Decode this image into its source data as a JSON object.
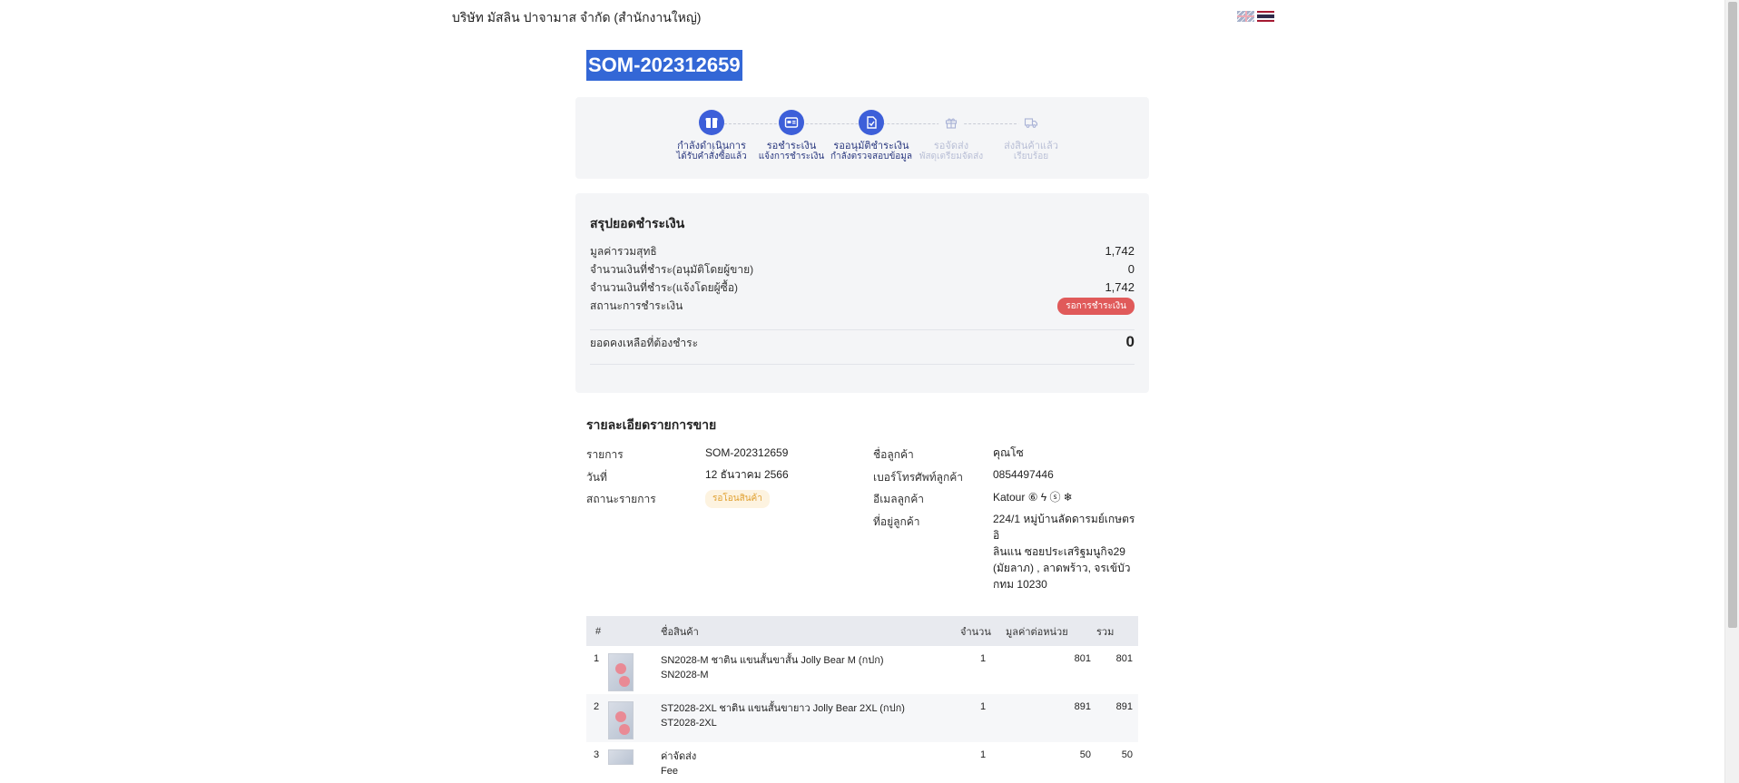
{
  "header": {
    "company": "บริษัท มัสลิน ปาจามาส จำกัด (สำนักงานใหญ่)"
  },
  "order": {
    "number": "SOM-202312659"
  },
  "steps": [
    {
      "title": "กำลังดำเนินการ",
      "sub": "ได้รับคำสั่งซื้อแล้ว",
      "icon": "box-icon",
      "active": true
    },
    {
      "title": "รอชำระเงิน",
      "sub": "แจ้งการชำระเงิน",
      "icon": "payment-card-icon",
      "active": true
    },
    {
      "title": "รออนุมัติชำระเงิน",
      "sub": "กำลังตรวจสอบข้อมูล",
      "icon": "document-check-icon",
      "active": true
    },
    {
      "title": "รอจัดส่ง",
      "sub": "พัสดุเตรียมจัดส่ง",
      "icon": "gift-icon",
      "active": false
    },
    {
      "title": "ส่งสินค้าแล้ว",
      "sub": "เรียบร้อย",
      "icon": "truck-icon",
      "active": false
    }
  ],
  "payment": {
    "title": "สรุปยอดชำระเงิน",
    "net_label": "มูลค่ารวมสุทธิ",
    "net_value": "1,742",
    "paid_approved_label": "จำนวนเงินที่ชำระ(อนุมัติโดยผู้ขาย)",
    "paid_approved_value": "0",
    "paid_buyer_label": "จำนวนเงินที่ชำระ(แจ้งโดยผู้ซื้อ)",
    "paid_buyer_value": "1,742",
    "status_label": "สถานะการชำระเงิน",
    "status_value": "รอการชำระเงิน",
    "balance_label": "ยอดคงเหลือที่ต้องชำระ",
    "balance_value": "0"
  },
  "details": {
    "title": "รายละเอียดรายการขาย",
    "order_label": "รายการ",
    "order_value": "SOM-202312659",
    "date_label": "วันที่",
    "date_value": "12 ธันวาคม 2566",
    "status_label": "สถานะรายการ",
    "status_value": "รอโอนสินค้า",
    "customer_label": "ชื่อลูกค้า",
    "customer_value": "คุณโซ",
    "phone_label": "เบอร์โทรศัพท์ลูกค้า",
    "phone_value": "0854497446",
    "email_label": "อีเมลลูกค้า",
    "email_value": "Katour ⑥ ϟ ⓢ ❄",
    "address_label": "ที่อยู่ลูกค้า",
    "address_line1": "224/1 หมู่บ้านลัดดารมย์เกษตรอิ",
    "address_line2": "ลินแน ซอยประเสริฐมนูกิจ29",
    "address_line3": "(มัยลาภ) , ลาดพร้าว, จรเข้บัว",
    "address_line4": "กทม 10230"
  },
  "table": {
    "headers": {
      "num": "#",
      "name": "ชื่อสินค้า",
      "qty": "จำนวน",
      "unit_price": "มูลค่าต่อหน่วย",
      "total": "รวม"
    },
    "rows": [
      {
        "num": "1",
        "name": "SN2028-M ชาติน แขนสั้นขาสั้น Jolly Bear M (กปก)",
        "sku": "SN2028-M",
        "qty": "1",
        "unit_price": "801",
        "total": "801"
      },
      {
        "num": "2",
        "name": "ST2028-2XL ชาติน แขนสั้นขายาว Jolly Bear 2XL (กปก)",
        "sku": "ST2028-2XL",
        "qty": "1",
        "unit_price": "891",
        "total": "891"
      },
      {
        "num": "3",
        "name": "ค่าจัดส่ง",
        "sku": "Fee",
        "qty": "1",
        "unit_price": "50",
        "total": "50"
      }
    ]
  },
  "colors": {
    "accent": "#3d5fd9",
    "selection": "#3367d6",
    "status_red": "#e05a5a",
    "status_yellow": "#e0a030"
  }
}
